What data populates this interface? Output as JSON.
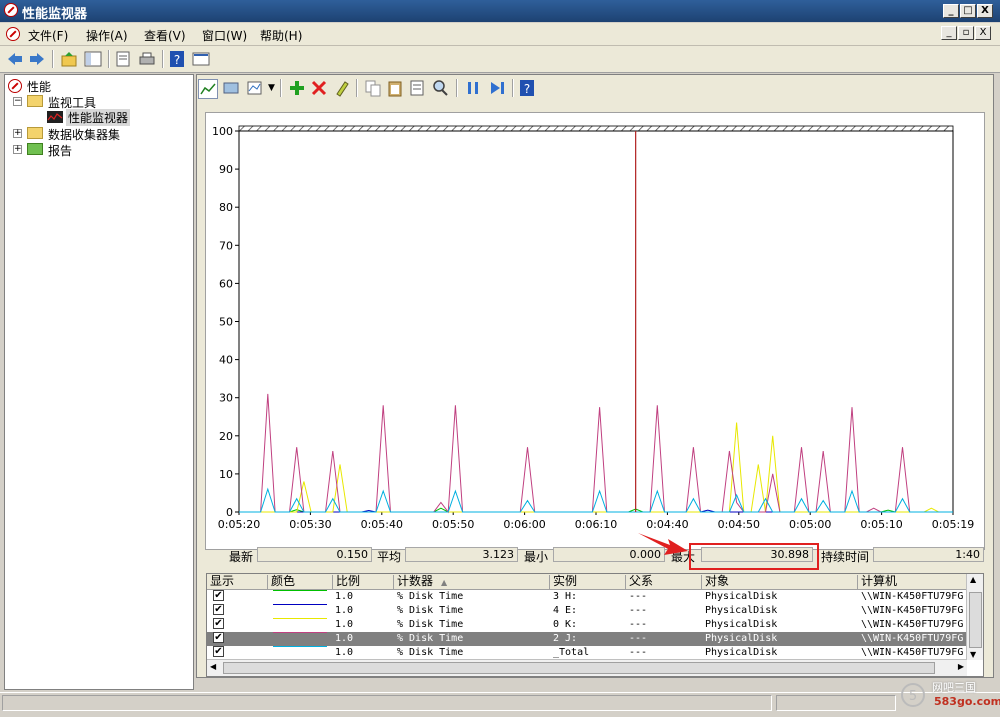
{
  "window": {
    "title": "性能监视器",
    "controls": [
      "_",
      "□",
      "X"
    ]
  },
  "menu": {
    "items": [
      "文件(F)",
      "操作(A)",
      "查看(V)",
      "窗口(W)",
      "帮助(H)"
    ],
    "mdi_controls": [
      "_",
      "▫",
      "X"
    ]
  },
  "tree": {
    "root": "性能",
    "monitor_tools": "监视工具",
    "perf_monitor": "性能监视器",
    "data_collector_sets": "数据收集器集",
    "reports": "报告"
  },
  "stats": {
    "last_label": "最新",
    "last_value": "0.150",
    "avg_label": "平均",
    "avg_value": "3.123",
    "min_label": "最小",
    "min_value": "0.000",
    "max_label": "最大",
    "max_value": "30.898",
    "duration_label": "持续时间",
    "duration_value": "1:40"
  },
  "table": {
    "headers": [
      "显示",
      "颜色",
      "比例",
      "计数器",
      "实例",
      "父系",
      "对象",
      "计算机"
    ],
    "rows": [
      {
        "scale": "1.0",
        "counter": "% Disk Time",
        "instance": "3 H:",
        "parent": "---",
        "object": "PhysicalDisk",
        "computer": "\\\\WIN-K450FTU79FG",
        "color": "#00c000",
        "selected": false
      },
      {
        "scale": "1.0",
        "counter": "% Disk Time",
        "instance": "4 E:",
        "parent": "---",
        "object": "PhysicalDisk",
        "computer": "\\\\WIN-K450FTU79FG",
        "color": "#0000c0",
        "selected": false
      },
      {
        "scale": "1.0",
        "counter": "% Disk Time",
        "instance": "0 K:",
        "parent": "---",
        "object": "PhysicalDisk",
        "computer": "\\\\WIN-K450FTU79FG",
        "color": "#e8e800",
        "selected": false
      },
      {
        "scale": "1.0",
        "counter": "% Disk Time",
        "instance": "2 J:",
        "parent": "---",
        "object": "PhysicalDisk",
        "computer": "\\\\WIN-K450FTU79FG",
        "color": "#c04080",
        "selected": true
      },
      {
        "scale": "1.0",
        "counter": "% Disk Time",
        "instance": "_Total",
        "parent": "---",
        "object": "PhysicalDisk",
        "computer": "\\\\WIN-K450FTU79FG",
        "color": "#00b0e0",
        "selected": false
      }
    ]
  },
  "watermark": {
    "site_cn": "网吧三国",
    "site_url": "583go.com"
  },
  "chart_data": {
    "type": "line",
    "ylim": [
      0,
      100
    ],
    "yticks": [
      "0",
      "10",
      "20",
      "30",
      "40",
      "50",
      "60",
      "70",
      "80",
      "90",
      "100"
    ],
    "xticks": [
      "0:05:20",
      "0:05:30",
      "0:05:40",
      "0:05:50",
      "0:06:00",
      "0:06:10",
      "0:04:40",
      "0:04:50",
      "0:05:00",
      "0:05:10",
      "0:05:19"
    ],
    "cursor_index": 55,
    "x_count": 100,
    "series": [
      {
        "name": "3 H:",
        "color": "#00c000",
        "points": [
          [
            8,
            0.6
          ],
          [
            28,
            1.0
          ],
          [
            55,
            0.8
          ],
          [
            90,
            0.5
          ]
        ]
      },
      {
        "name": "4 E:",
        "color": "#0000c0",
        "points": [
          [
            18,
            0.4
          ],
          [
            65,
            0.5
          ]
        ]
      },
      {
        "name": "0 K:",
        "color": "#e8e800",
        "points": [
          [
            9,
            8
          ],
          [
            14,
            12.5
          ],
          [
            69,
            23.5
          ],
          [
            72,
            12.5
          ],
          [
            74,
            20
          ],
          [
            96,
            1
          ]
        ]
      },
      {
        "name": "2 J:",
        "color": "#c04080",
        "points": [
          [
            4,
            31
          ],
          [
            8,
            17
          ],
          [
            13,
            16
          ],
          [
            20,
            28
          ],
          [
            30,
            28
          ],
          [
            40,
            17
          ],
          [
            50,
            27.5
          ],
          [
            58,
            28
          ],
          [
            63,
            17
          ],
          [
            68,
            16
          ],
          [
            74,
            10
          ],
          [
            78,
            17
          ],
          [
            81,
            16
          ],
          [
            85,
            27.5
          ],
          [
            92,
            17
          ],
          [
            28,
            2.5
          ],
          [
            69,
            2.5
          ],
          [
            88,
            1
          ]
        ]
      },
      {
        "name": "_Total",
        "color": "#00b0e0",
        "points": [
          [
            4,
            6
          ],
          [
            8,
            3.5
          ],
          [
            13,
            3.5
          ],
          [
            20,
            5.5
          ],
          [
            30,
            5.5
          ],
          [
            40,
            3
          ],
          [
            50,
            5.5
          ],
          [
            58,
            5.5
          ],
          [
            63,
            3.5
          ],
          [
            69,
            4.5
          ],
          [
            73,
            3.5
          ],
          [
            78,
            3.5
          ],
          [
            81,
            3
          ],
          [
            85,
            5.5
          ],
          [
            92,
            3.5
          ]
        ]
      }
    ]
  }
}
